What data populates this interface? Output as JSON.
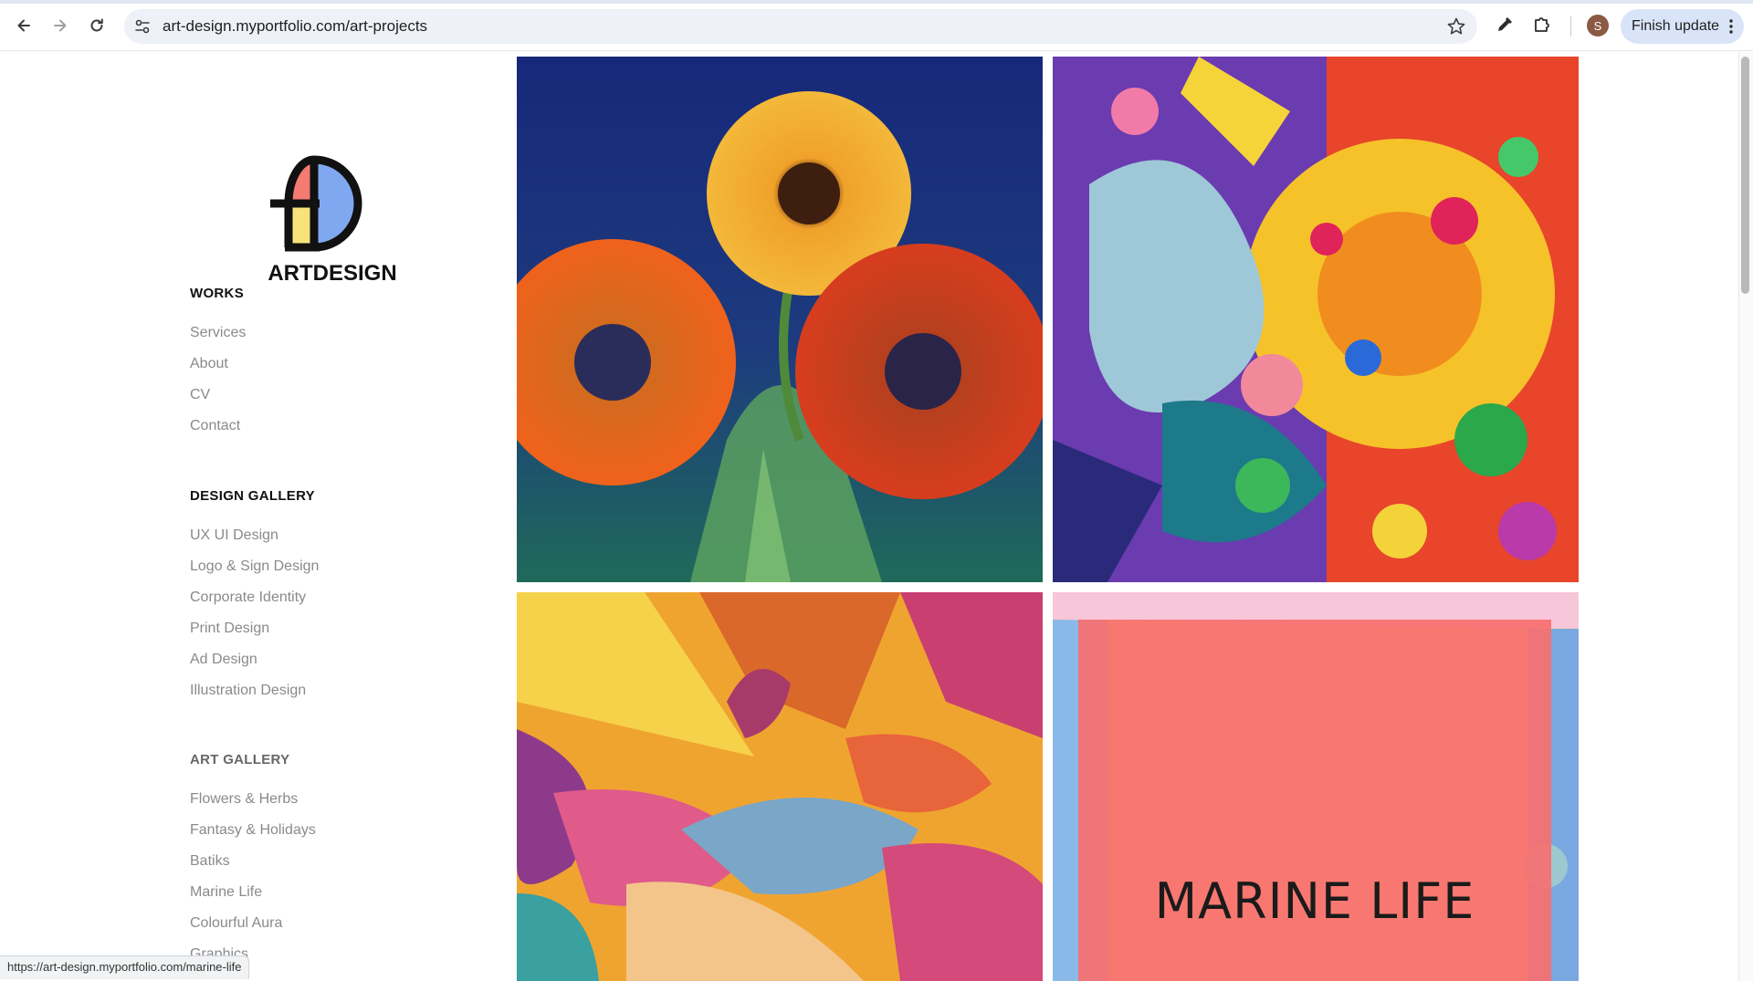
{
  "browser": {
    "url": "art-design.myportfolio.com/art-projects",
    "finish_update_label": "Finish update",
    "profile_initial": "S",
    "status_url": "https://art-design.myportfolio.com/marine-life"
  },
  "logo": {
    "text": "ARTDESIGN",
    "colors": {
      "red": "#f47a72",
      "yellow": "#f7e37a",
      "blue": "#7fa8f0",
      "stroke": "#111111"
    }
  },
  "nav": {
    "works_heading": "WORKS",
    "works_links": [
      "Services",
      "About",
      "CV",
      "Contact"
    ],
    "design_heading": "DESIGN GALLERY",
    "design_links": [
      "UX UI Design",
      "Logo & Sign Design",
      "Corporate Identity",
      "Print Design",
      "Ad Design",
      "Illustration Design"
    ],
    "art_heading": "ART GALLERY",
    "art_links": [
      "Flowers & Herbs",
      "Fantasy & Holidays",
      "Batiks",
      "Marine Life",
      "Colourful Aura",
      "Graphics"
    ]
  },
  "gallery": {
    "marine_title": "MARINE LIFE"
  }
}
